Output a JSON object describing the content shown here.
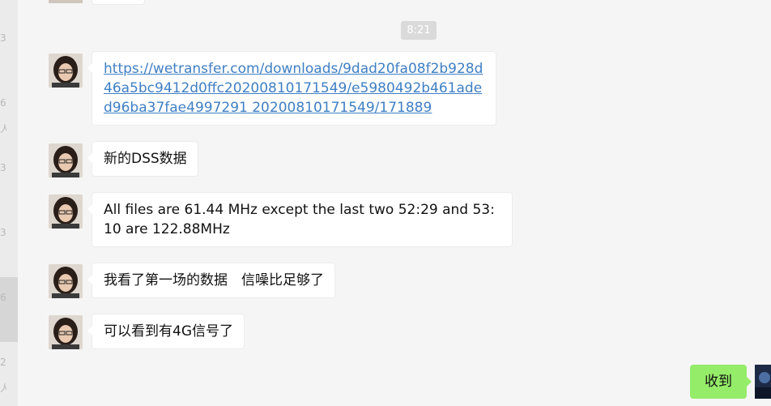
{
  "left_fragments": [
    "3",
    "6",
    "人",
    "3",
    "3",
    "6",
    "2",
    "人"
  ],
  "time_label": "8:21",
  "messages": [
    {
      "text": "https://wetransfer.com/downloads/9dad20fa08f2b928d46a5bc9412d0ffc20200810171549/e5980492b461aded96ba37fae4997291 20200810171549/171889",
      "is_link": true
    },
    {
      "text": "新的DSS数据"
    },
    {
      "text": "All files are 61.44 MHz except the last two 52:29 and 53:10 are 122.88MHz"
    },
    {
      "text": "我看了第一场的数据　信噪比足够了"
    },
    {
      "text": "可以看到有4G信号了"
    }
  ],
  "my_reply": "收到",
  "colors": {
    "background": "#f5f5f5",
    "bubble_incoming": "#ffffff",
    "bubble_outgoing": "#95ec69",
    "link": "#3f7fc4",
    "time_badge": "#dadada"
  }
}
